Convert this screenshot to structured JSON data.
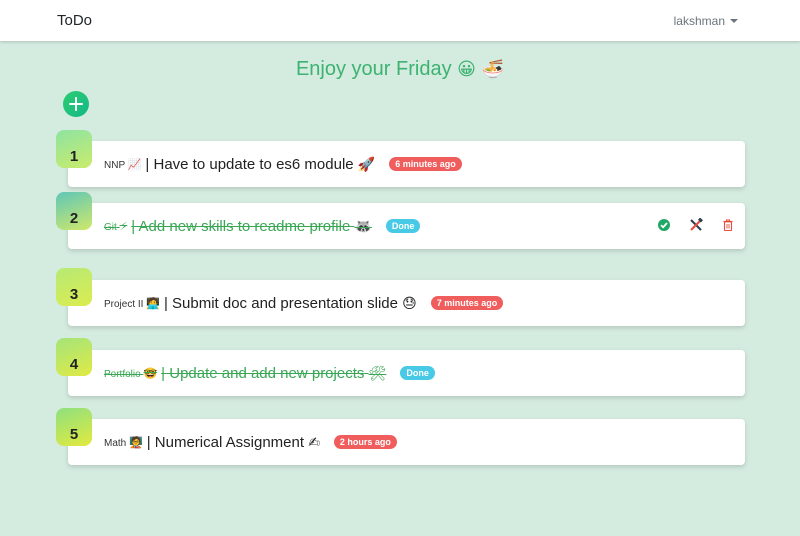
{
  "navbar": {
    "brand": "ToDo",
    "user": "lakshman"
  },
  "greeting": {
    "text": "Enjoy your Friday",
    "emoji": "😀 🍜"
  },
  "colors": {
    "accent": "#3cb371",
    "time_badge": "#ef5d5d",
    "done_badge": "#48c9e6",
    "background": "#d4ebdf"
  },
  "todos": [
    {
      "number": "1",
      "tag": "NNP",
      "tag_emoji": "📈",
      "title": "| Have to update to es6 module",
      "title_emoji": "🚀",
      "badge": "6 minutes ago",
      "done": false
    },
    {
      "number": "2",
      "tag": "Git",
      "tag_emoji": "⚡",
      "title": "| Add new skills to readme profile",
      "title_emoji": "🦝",
      "badge": "Done",
      "done": true
    },
    {
      "number": "3",
      "tag": "Project II",
      "tag_emoji": "🧑‍💻",
      "title": "| Submit doc and presentation slide",
      "title_emoji": "😓",
      "badge": "7 minutes ago",
      "done": false
    },
    {
      "number": "4",
      "tag": "Portfolio",
      "tag_emoji": "🤓",
      "title": "| Update and add new projects",
      "title_emoji": "🛠",
      "badge": "Done",
      "done": true
    },
    {
      "number": "5",
      "tag": "Math",
      "tag_emoji": "🧑‍🏫",
      "title": "| Numerical Assignment",
      "title_emoji": "✍",
      "badge": "2 hours ago",
      "done": false
    }
  ],
  "icons": {
    "add": "plus-circle-icon",
    "complete": "check-circle-icon",
    "edit": "tools-icon",
    "delete": "trash-icon"
  }
}
